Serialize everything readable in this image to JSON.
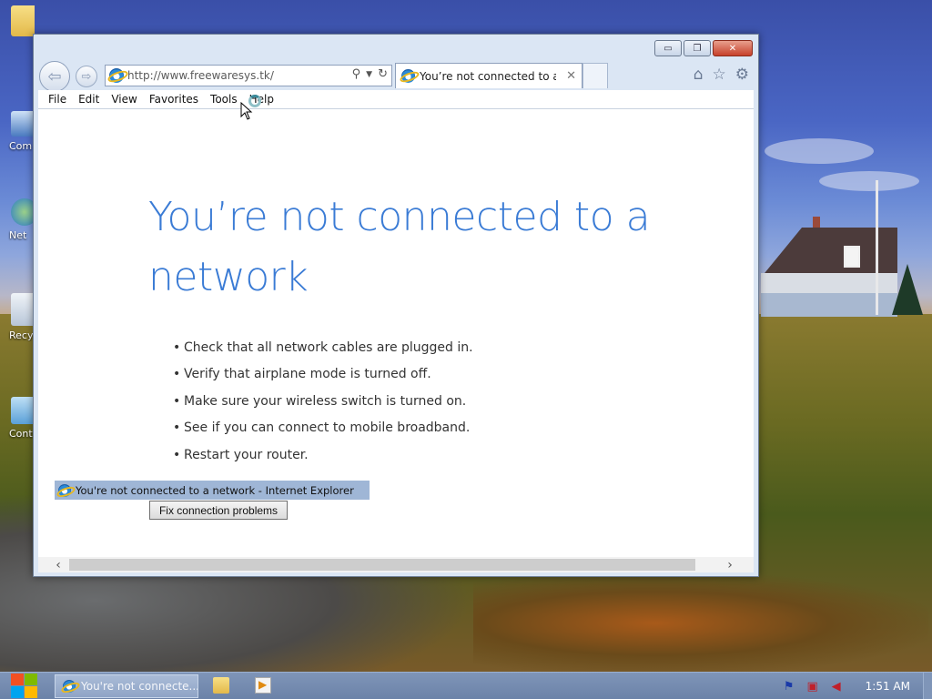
{
  "desktop": {
    "icons": [
      {
        "label": "Com"
      },
      {
        "label": "Net"
      },
      {
        "label": "Recy"
      },
      {
        "label": "Contr"
      }
    ]
  },
  "browser": {
    "address": {
      "url": "http://www.freewaresys.tk/"
    },
    "tab": {
      "title": "You’re not connected to a ...",
      "close_glyph": "✕"
    },
    "menu": [
      "File",
      "Edit",
      "View",
      "Favorites",
      "Tools",
      "Help"
    ],
    "error_page": {
      "title": "You’re not connected to a network",
      "tips": [
        "Check that all network cables are plugged in.",
        "Verify that airplane mode is turned off.",
        "Make sure your wireless switch is turned on.",
        "See if you can connect to mobile broadband.",
        "Restart your router."
      ],
      "tooltip_title": "You're not connected to a network - Internet Explorer",
      "fix_button": "Fix connection problems"
    },
    "caption": {
      "minimize": "▭",
      "restore": "❐",
      "close": "✕"
    }
  },
  "taskbar": {
    "active_task": "You're not connecte...",
    "clock": "1:51 AM"
  },
  "colors": {
    "error_title": "#3a7bd5",
    "window_frame": "#dbe6f4",
    "taskbar": "#7f95b8"
  },
  "icons": {
    "back": "back-arrow-icon",
    "forward": "forward-arrow-icon",
    "search": "search-icon",
    "refresh": "refresh-icon",
    "home": "home-icon",
    "favorites": "star-icon",
    "tools": "gear-icon"
  }
}
